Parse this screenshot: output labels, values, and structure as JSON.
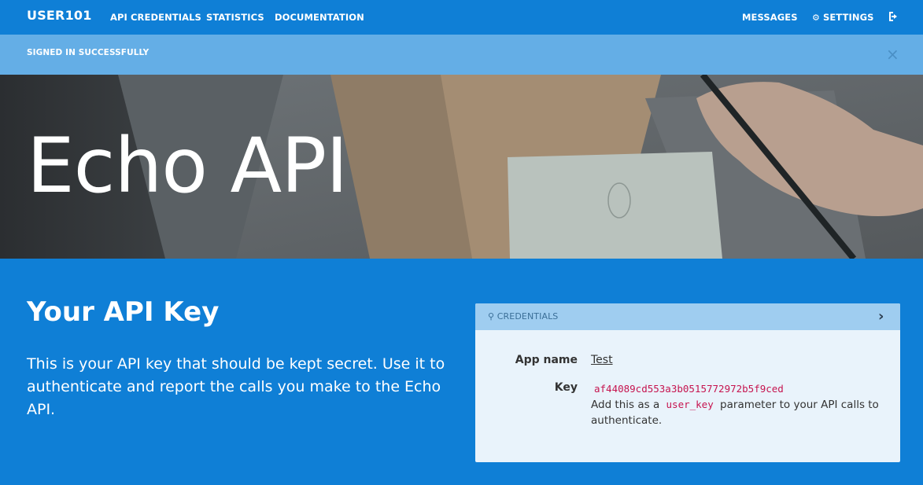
{
  "nav": {
    "brand": "USER101",
    "links": [
      {
        "label": "API CREDENTIALS"
      },
      {
        "label": "STATISTICS"
      },
      {
        "label": "DOCUMENTATION"
      }
    ],
    "messages": "MESSAGES",
    "settings": "SETTINGS",
    "settings_icon": "gear-icon",
    "logout_icon": "sign-out-icon"
  },
  "flash": {
    "text": "SIGNED IN SUCCESSFULLY",
    "close": "×"
  },
  "hero": {
    "title": "Echo API"
  },
  "main": {
    "heading": "Your API Key",
    "description": "This is your API key that should be kept secret. Use it to authenticate and report the calls you make to the Echo API."
  },
  "credentials": {
    "header": "CREDENTIALS",
    "header_icon": "key-icon",
    "chevron": "›",
    "app_name_label": "App name",
    "app_name": "Test",
    "key_label": "Key",
    "key_value": "af44089cd553a3b0515772972b5f9ced",
    "help_before": "Add this as a",
    "help_code": "user_key",
    "help_after": "parameter to your API calls to authenticate."
  },
  "colors": {
    "primary": "#0f7fd6",
    "flash": "#64aee6",
    "panel_head": "#9fcdf0",
    "panel_body": "#e9f3fb",
    "code": "#c6144f"
  }
}
